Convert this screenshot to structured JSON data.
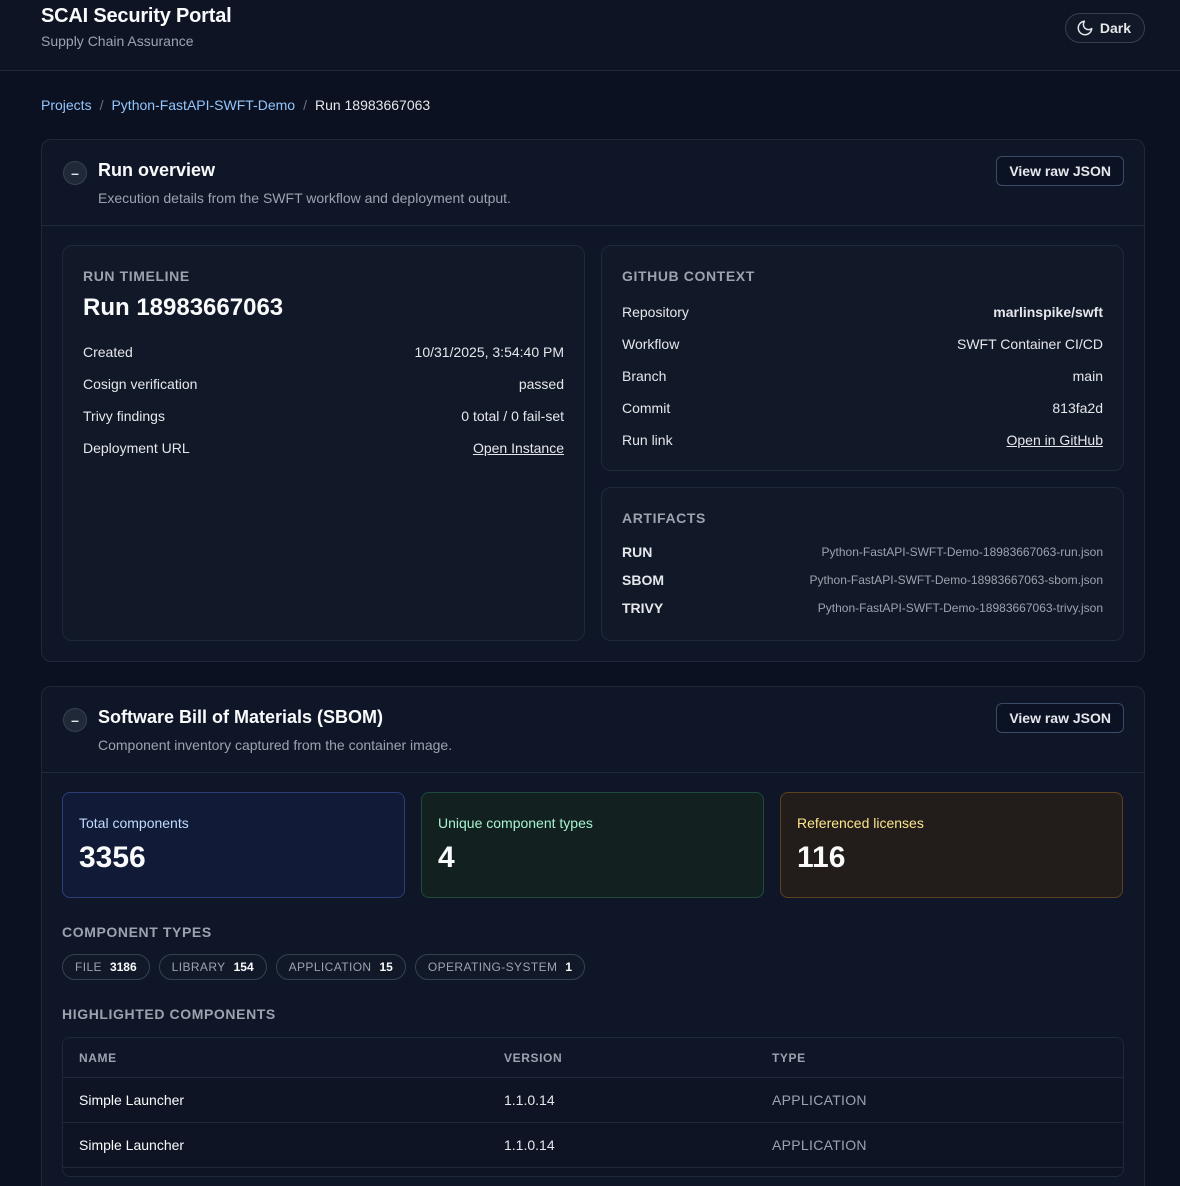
{
  "header": {
    "title": "SCAI Security Portal",
    "subtitle": "Supply Chain Assurance",
    "theme_toggle": "Dark"
  },
  "breadcrumb": {
    "items": [
      "Projects",
      "Python-FastAPI-SWFT-Demo"
    ],
    "current": "Run 18983667063",
    "separator": "/"
  },
  "run_overview": {
    "collapse": "–",
    "title": "Run overview",
    "description": "Execution details from the SWFT workflow and deployment output.",
    "raw_json_label": "View raw JSON",
    "timeline": {
      "label": "RUN TIMELINE",
      "run_title": "Run 18983667063",
      "rows": [
        {
          "key": "Created",
          "value": "10/31/2025, 3:54:40 PM"
        },
        {
          "key": "Cosign verification",
          "value": "passed"
        },
        {
          "key": "Trivy findings",
          "value": "0 total / 0 fail-set"
        },
        {
          "key": "Deployment URL",
          "value": "Open Instance"
        }
      ]
    },
    "github": {
      "label": "GITHUB CONTEXT",
      "rows": [
        {
          "key": "Repository",
          "value": "marlinspike/swft"
        },
        {
          "key": "Workflow",
          "value": "SWFT Container CI/CD"
        },
        {
          "key": "Branch",
          "value": "main"
        },
        {
          "key": "Commit",
          "value": "813fa2d"
        },
        {
          "key": "Run link",
          "value": "Open in GitHub"
        }
      ]
    },
    "artifacts": {
      "label": "ARTIFACTS",
      "rows": [
        {
          "key": "RUN",
          "value": "Python-FastAPI-SWFT-Demo-18983667063-run.json"
        },
        {
          "key": "SBOM",
          "value": "Python-FastAPI-SWFT-Demo-18983667063-sbom.json"
        },
        {
          "key": "TRIVY",
          "value": "Python-FastAPI-SWFT-Demo-18983667063-trivy.json"
        }
      ]
    }
  },
  "sbom": {
    "collapse": "–",
    "title": "Software Bill of Materials (SBOM)",
    "description": "Component inventory captured from the container image.",
    "raw_json_label": "View raw JSON",
    "stats": [
      {
        "label": "Total components",
        "value": "3356"
      },
      {
        "label": "Unique component types",
        "value": "4"
      },
      {
        "label": "Referenced licenses",
        "value": "116"
      }
    ],
    "component_types_label": "COMPONENT TYPES",
    "component_types": [
      {
        "name": "FILE",
        "count": "3186"
      },
      {
        "name": "LIBRARY",
        "count": "154"
      },
      {
        "name": "APPLICATION",
        "count": "15"
      },
      {
        "name": "OPERATING-SYSTEM",
        "count": "1"
      }
    ],
    "highlighted_label": "HIGHLIGHTED COMPONENTS",
    "table": {
      "headers": [
        "NAME",
        "VERSION",
        "TYPE"
      ],
      "rows": [
        {
          "name": "Simple Launcher",
          "version": "1.1.0.14",
          "type": "APPLICATION"
        },
        {
          "name": "Simple Launcher",
          "version": "1.1.0.14",
          "type": "APPLICATION"
        }
      ]
    }
  }
}
